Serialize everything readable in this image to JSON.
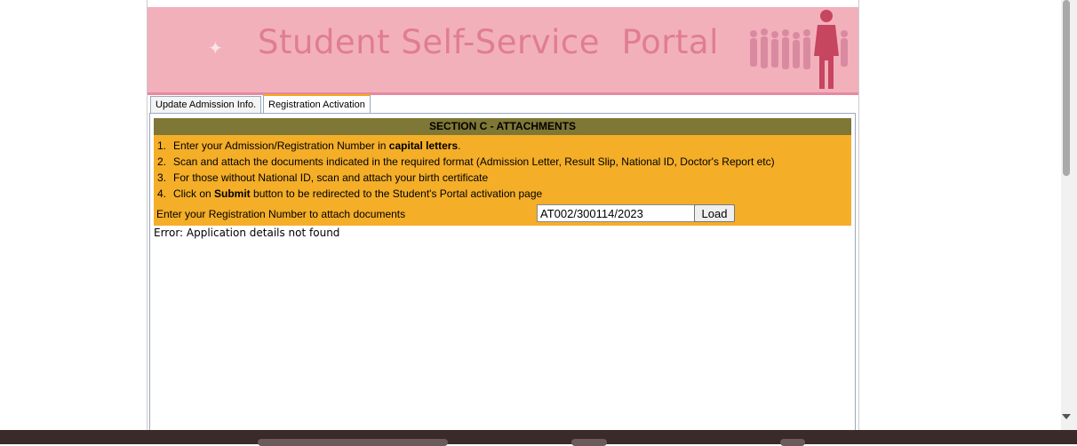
{
  "banner": {
    "title_part1": "Student Self-Service",
    "title_part2": "Portal"
  },
  "tabs": [
    {
      "label": "Update Admission Info.",
      "active": false
    },
    {
      "label": "Registration Activation",
      "active": true
    }
  ],
  "section": {
    "header": "SECTION C - ATTACHMENTS",
    "instructions": [
      {
        "num": "1.",
        "before": "Enter your Admission/Registration Number in ",
        "bold": "capital letters",
        "after": "."
      },
      {
        "num": "2.",
        "before": "Scan and attach the documents indicated in the required format (Admission Letter, Result Slip, National ID, Doctor's Report etc)",
        "bold": "",
        "after": ""
      },
      {
        "num": "3.",
        "before": "For those without National ID, scan and attach your birth certificate",
        "bold": "",
        "after": ""
      },
      {
        "num": "4.",
        "before": "Click on ",
        "bold": "Submit",
        "after": " button to be redirected to the Student's Portal activation page"
      }
    ],
    "reg_label": "Enter your Registration Number to attach documents",
    "reg_value": "AT002/300114/2023",
    "load_label": "Load"
  },
  "error_message": "Error: Application details not found",
  "colors": {
    "banner_bg": "#f2b0bb",
    "banner_title": "#e07d92",
    "section_header_bg": "#7f7735",
    "instructions_bg": "#f4ae28",
    "top_bar_1": "#4aa3ad",
    "top_bar_2": "#f2a81c",
    "top_bar_3": "#d8193f"
  }
}
